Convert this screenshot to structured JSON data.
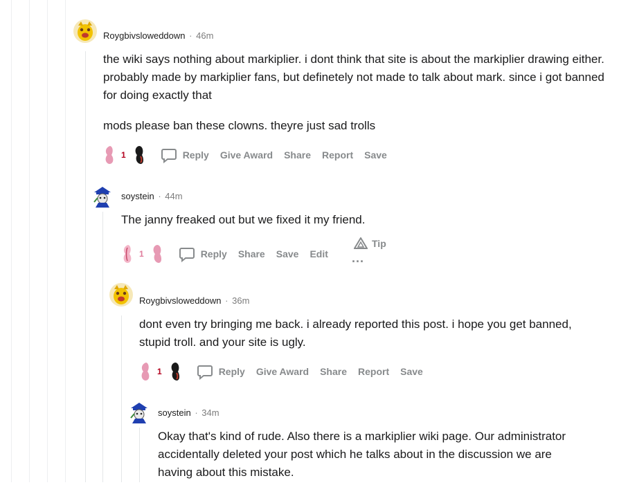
{
  "comments": [
    {
      "author": "Roygbivsloweddown",
      "time": "46m",
      "paragraphs": [
        "the wiki says nothing about markiplier. i dont think that site is about the markiplier drawing either. probably made by markiplier fans, but definetely not made to talk about mark. since i got banned for doing exactly that",
        "mods please ban these clowns. theyre just sad trolls"
      ],
      "score": "1",
      "actions": [
        "Reply",
        "Give Award",
        "Share",
        "Report",
        "Save"
      ]
    },
    {
      "author": "soystein",
      "time": "44m",
      "paragraphs": [
        "The janny freaked out but we fixed it my friend."
      ],
      "score": "1",
      "actions": [
        "Reply",
        "Share",
        "Save",
        "Edit"
      ],
      "tip_label": "Tip",
      "more_label": "..."
    },
    {
      "author": "Roygbivsloweddown",
      "time": "36m",
      "paragraphs": [
        "dont even try bringing me back. i already reported this post. i hope you get banned, stupid troll. and your site is ugly."
      ],
      "score": "1",
      "actions": [
        "Reply",
        "Give Award",
        "Share",
        "Report",
        "Save"
      ]
    },
    {
      "author": "soystein",
      "time": "34m",
      "paragraphs": [
        "Okay that's kind of rude. Also there is a markiplier wiki page. Our administrator accidentally deleted your post which he talks about in the discussion we are having about this mistake."
      ]
    }
  ],
  "separator": "·",
  "colors": {
    "upvote_pink": "#e79ab4",
    "downvote_dark": "#1a1a1a",
    "score_red": "#b3001e",
    "muted": "#878a8c"
  }
}
